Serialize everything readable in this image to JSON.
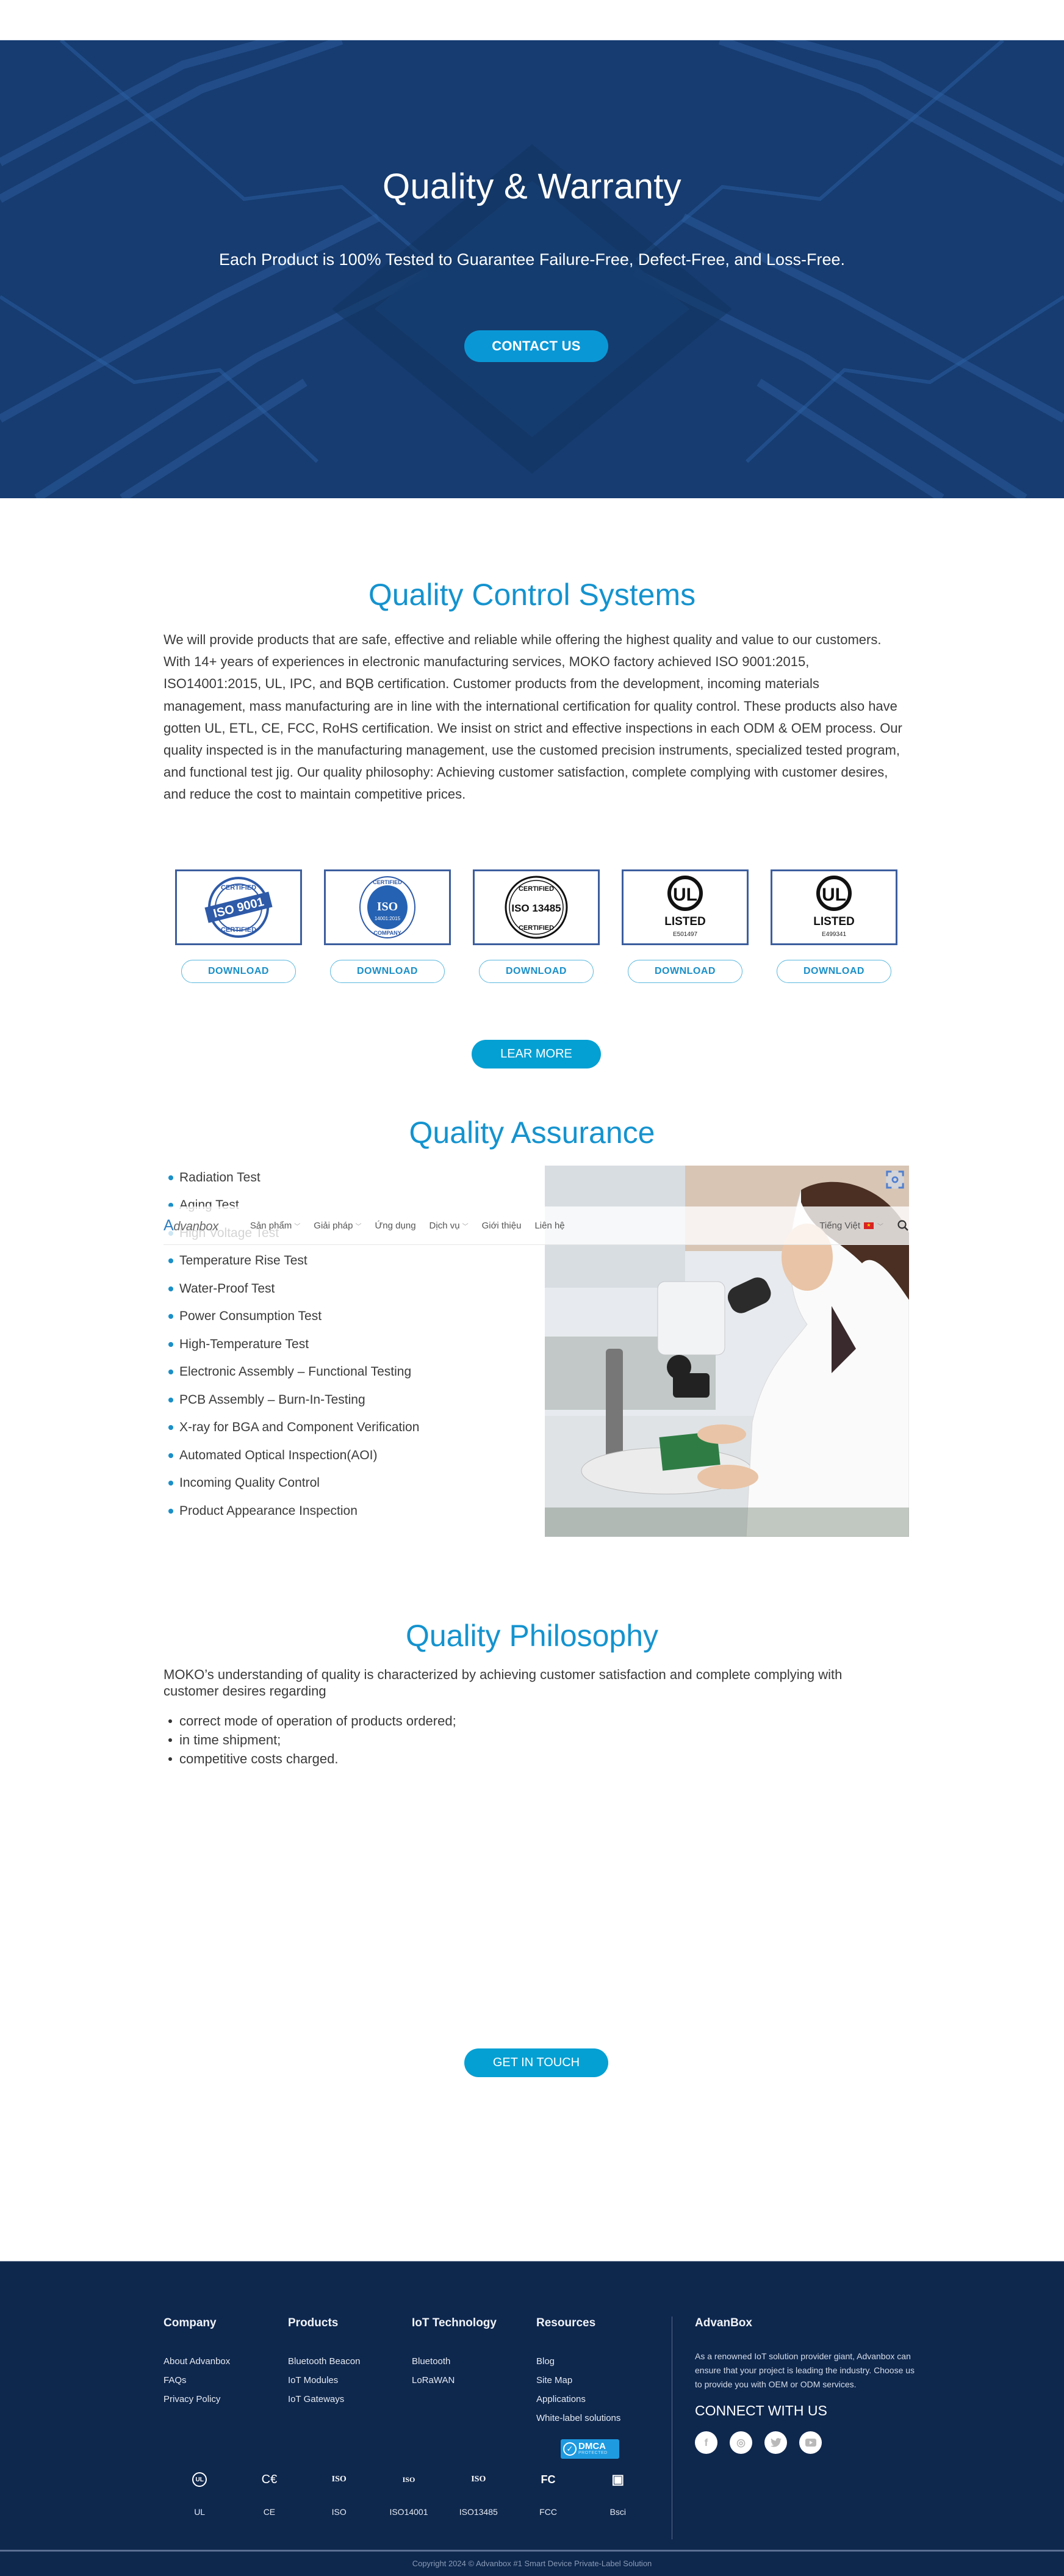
{
  "hero": {
    "title": "Quality & Warranty",
    "subtitle": "Each Product is 100% Tested to Guarantee Failure-Free, Defect-Free, and Loss-Free.",
    "cta_label": "CONTACT US"
  },
  "quality_control": {
    "title": "Quality Control Systems",
    "body": "We will provide products that are safe, effective and reliable while offering the highest quality and value to our customers. With 14+ years of experiences in electronic manufacturing services, MOKO factory achieved ISO 9001:2015, ISO14001:2015, UL, IPC, and BQB certification. Customer products from the development, incoming materials management, mass manufacturing are in line with the international certification for quality control. These products also have gotten UL, ETL, CE, FCC, RoHS certification. We insist on strict and effective inspections in each ODM & OEM process. Our quality inspected is in the manufacturing management, use the customed precision instruments, specialized tested program, and functional test jig. Our quality philosophy: Achieving customer satisfaction, complete complying with customer desires, and reduce the cost to maintain competitive prices.",
    "certificates": [
      {
        "name": "iso-9001-certificate",
        "top": "CERTIFIED",
        "main": "ISO 9001",
        "bottom": "CERTIFIED",
        "download_label": "DOWNLOAD"
      },
      {
        "name": "iso-14001-certificate",
        "top": "CERTIFIED",
        "main": "ISO",
        "sub": "14001:2015",
        "bottom": "COMPANY",
        "download_label": "DOWNLOAD"
      },
      {
        "name": "iso-13485-certificate",
        "top": "CERTIFIED",
        "main": "ISO 13485",
        "bottom": "CERTIFIED",
        "download_label": "DOWNLOAD"
      },
      {
        "name": "ul-listed-certificate-1",
        "main": "LISTED",
        "code": "E501497",
        "download_label": "DOWNLOAD"
      },
      {
        "name": "ul-listed-certificate-2",
        "main": "LISTED",
        "code": "E499341",
        "download_label": "DOWNLOAD"
      }
    ],
    "learn_more_label": "LEAR MORE"
  },
  "quality_assurance": {
    "title": "Quality Assurance",
    "items": [
      "Radiation Test",
      "Aging Test",
      "High Voltage Test",
      "Temperature Rise Test",
      "Water-Proof Test",
      "Power Consumption Test",
      "High-Temperature Test",
      "Electronic Assembly – Functional Testing",
      "PCB Assembly – Burn-In-Testing",
      "X-ray for BGA and Component Verification",
      "Automated Optical Inspection(AOI)",
      "Incoming Quality Control",
      "Product Appearance Inspection"
    ]
  },
  "sticky_header": {
    "logo_initial": "A",
    "logo_rest": "dvanbox",
    "nav": [
      {
        "label": "Sản phẩm",
        "has_dropdown": true
      },
      {
        "label": "Giải pháp",
        "has_dropdown": true
      },
      {
        "label": "Ứng dụng",
        "has_dropdown": false
      },
      {
        "label": "Dịch vụ",
        "has_dropdown": true
      },
      {
        "label": "Giới thiệu",
        "has_dropdown": false
      },
      {
        "label": "Liên hệ",
        "has_dropdown": false
      }
    ],
    "language": "Tiếng Việt"
  },
  "quality_philosophy": {
    "title": "Quality Philosophy",
    "intro": "MOKO’s understanding of quality is characterized by achieving customer satisfaction and complete complying with customer desires regarding",
    "items": [
      "correct mode of operation of products ordered;",
      "in time shipment;",
      "competitive costs charged."
    ],
    "cta_label": "GET IN TOUCH"
  },
  "footer": {
    "columns": [
      {
        "title": "Company",
        "links": [
          "About Advanbox",
          "FAQs",
          "Privacy Policy"
        ]
      },
      {
        "title": "Products",
        "links": [
          "Bluetooth Beacon",
          "IoT Modules",
          "IoT Gateways"
        ]
      },
      {
        "title": "IoT Technology",
        "links": [
          "Bluetooth",
          "LoRaWAN"
        ]
      },
      {
        "title": "Resources",
        "links": [
          "Blog",
          "Site Map",
          "Applications",
          "White-label solutions"
        ]
      }
    ],
    "dmca": {
      "line1": "DMCA",
      "line2": "PROTECTED"
    },
    "badges": [
      {
        "icon": "ul-icon",
        "glyph": "UL",
        "label": "UL"
      },
      {
        "icon": "ce-icon",
        "glyph": "C€",
        "label": "CE"
      },
      {
        "icon": "iso-icon",
        "glyph": "ISO",
        "label": "ISO"
      },
      {
        "icon": "iso14001-icon",
        "glyph": "ISO",
        "label": "ISO14001"
      },
      {
        "icon": "iso13485-icon",
        "glyph": "ISO",
        "label": "ISO13485"
      },
      {
        "icon": "fcc-icon",
        "glyph": "FC",
        "label": "FCC"
      },
      {
        "icon": "bsci-icon",
        "glyph": "▣",
        "label": "Bsci"
      }
    ],
    "about": {
      "title": "AdvanBox",
      "text": "As a renowned IoT solution provider giant, Advanbox can ensure that your project is leading the industry. Choose us to provide you with OEM or ODM services.",
      "connect_title": "CONNECT WITH US",
      "socials": [
        {
          "name": "facebook-icon",
          "glyph": "f"
        },
        {
          "name": "instagram-icon",
          "glyph": "◎"
        },
        {
          "name": "twitter-icon",
          "glyph": "🐦"
        },
        {
          "name": "youtube-icon",
          "glyph": "▶"
        }
      ]
    },
    "copyright": "Copyright 2024 © Advanbox #1 Smart Device Private-Label Solution"
  }
}
